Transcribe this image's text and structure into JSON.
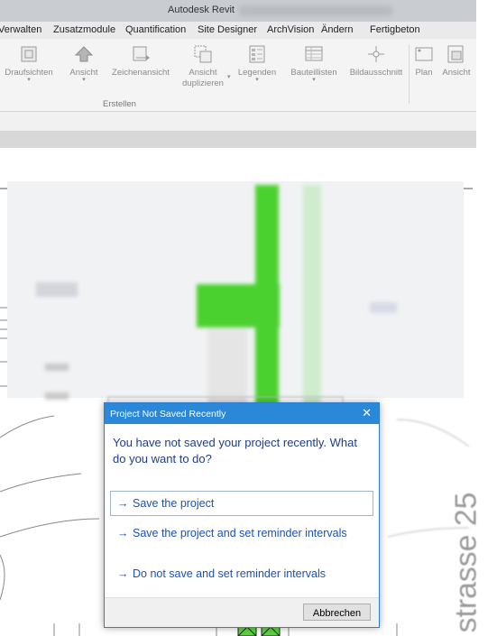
{
  "titlebar": {
    "app_name": "Autodesk Revit"
  },
  "menu_tabs": [
    "Verwalten",
    "Zusatzmodule",
    "Quantification",
    "Site Designer",
    "ArchVision",
    "Ändern",
    "Fertigbeton"
  ],
  "ribbon": {
    "buttons": [
      {
        "label": "Draufsichten",
        "has_dropdown": true,
        "icon": "floor-plan-icon"
      },
      {
        "label": "Ansicht",
        "has_dropdown": true,
        "icon": "elevation-icon"
      },
      {
        "label": "Zeichenansicht",
        "has_dropdown": false,
        "icon": "drafting-view-icon"
      },
      {
        "label": "Ansicht duplizieren",
        "has_dropdown": true,
        "icon": "duplicate-view-icon"
      },
      {
        "label": "Legenden",
        "has_dropdown": true,
        "icon": "legend-icon"
      },
      {
        "label": "Bauteillisten",
        "has_dropdown": true,
        "icon": "schedule-icon"
      },
      {
        "label": "Bildausschnitt",
        "has_dropdown": false,
        "icon": "scope-box-icon"
      },
      {
        "label": "Plan",
        "has_dropdown": false,
        "icon": "sheet-icon"
      },
      {
        "label": "Ansicht",
        "has_dropdown": false,
        "icon": "place-view-icon"
      }
    ],
    "group_label": "Erstellen"
  },
  "canvas": {
    "street_label": "strasse 25",
    "highlight_color": "#4bd12f"
  },
  "dialog": {
    "title": "Project Not Saved Recently",
    "instruction": "You have not saved your project recently. What do you want to do?",
    "commands": [
      {
        "arrow": "→",
        "label": "Save the project"
      },
      {
        "arrow": "→",
        "label": "Save the project and set reminder intervals"
      },
      {
        "arrow": "→",
        "label": "Do not save and set reminder intervals"
      }
    ],
    "cancel_label": "Abbrechen",
    "close_glyph": "✕"
  }
}
